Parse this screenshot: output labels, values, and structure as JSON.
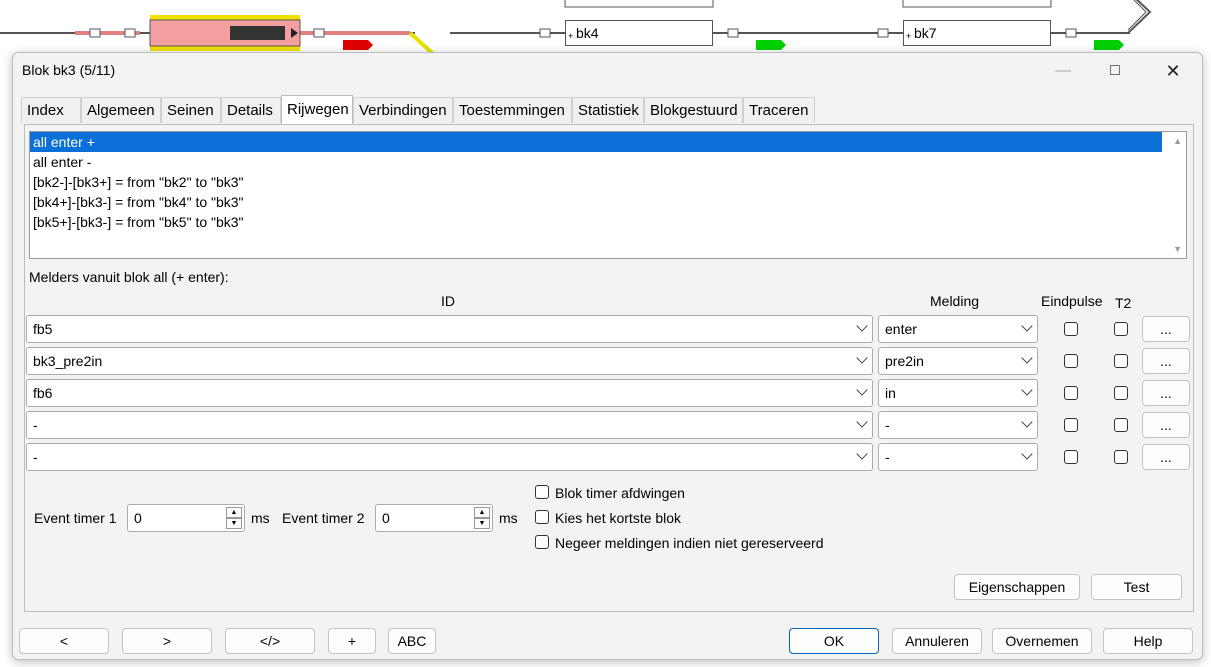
{
  "track": {
    "blocks": [
      "bk4",
      "bk7"
    ]
  },
  "dialog": {
    "title": "Blok bk3 (5/11)",
    "tabs": [
      "Index",
      "Algemeen",
      "Seinen",
      "Details",
      "Rijwegen",
      "Verbindingen",
      "Toestemmingen",
      "Statistiek",
      "Blokgestuurd",
      "Traceren"
    ],
    "active_tab": "Rijwegen",
    "routes": [
      "all enter +",
      "all enter -",
      "[bk2-]-[bk3+] = from \"bk2\" to \"bk3\"",
      "[bk4+]-[bk3-] = from \"bk4\" to \"bk3\"",
      "[bk5+]-[bk3-] = from \"bk5\" to \"bk3\""
    ],
    "selected_route": 0,
    "detectors_label": "Melders vanuit blok all (+ enter):",
    "headers": {
      "id": "ID",
      "melding": "Melding",
      "eindpulse": "Eindpulse",
      "t2": "T2"
    },
    "detectors": [
      {
        "id": "fb5",
        "melding": "enter",
        "eindpulse": false,
        "t2": false
      },
      {
        "id": "bk3_pre2in",
        "melding": "pre2in",
        "eindpulse": false,
        "t2": false
      },
      {
        "id": "fb6",
        "melding": "in",
        "eindpulse": false,
        "t2": false
      },
      {
        "id": "-",
        "melding": "-",
        "eindpulse": false,
        "t2": false
      },
      {
        "id": "-",
        "melding": "-",
        "eindpulse": false,
        "t2": false
      }
    ],
    "dots_label": "...",
    "event_timer1_label": "Event timer 1",
    "event_timer1_value": "0",
    "event_timer2_label": "Event timer 2",
    "event_timer2_value": "0",
    "ms_label": "ms",
    "options": [
      {
        "label": "Blok timer afdwingen",
        "checked": false
      },
      {
        "label": "Kies het kortste blok",
        "checked": false
      },
      {
        "label": "Negeer meldingen indien niet gereserveerd",
        "checked": false
      }
    ],
    "properties_button": "Eigenschappen",
    "test_button": "Test",
    "footer_left": [
      "<",
      ">",
      "</>",
      "+",
      "ABC"
    ],
    "ok_button": "OK",
    "cancel_button": "Annuleren",
    "apply_button": "Overnemen",
    "help_button": "Help"
  },
  "colors": {
    "accent": "#0a6fd6",
    "block_occupied": "#f4a0a0",
    "block_border": "#f0e000",
    "signal_red": "#e00000",
    "signal_green": "#00d000"
  }
}
